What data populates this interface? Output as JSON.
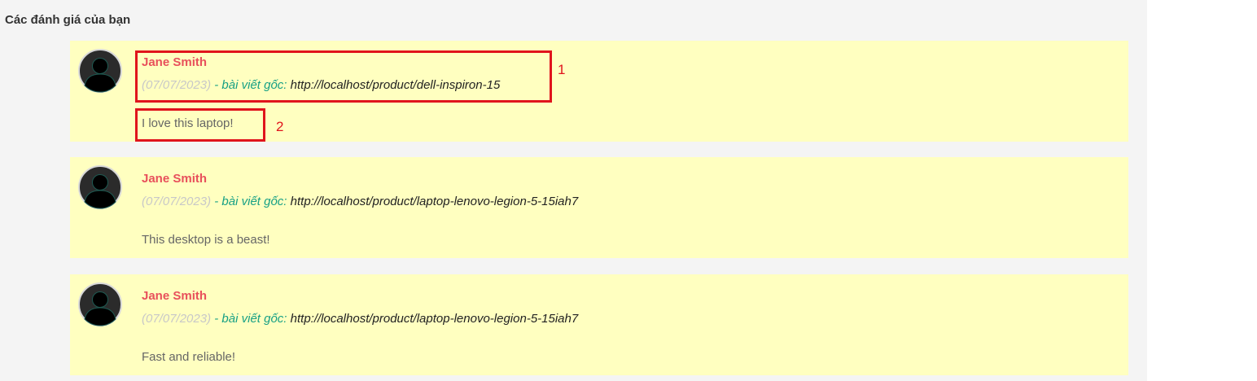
{
  "section": {
    "title": "Các đánh giá của bạn"
  },
  "reviews": [
    {
      "author": "Jane Smith",
      "date": "(07/07/2023)",
      "separator": " - ",
      "source_label": "bài viết gốc:",
      "url": " http://localhost/product/dell-inspiron-15",
      "comment": "I love this laptop!"
    },
    {
      "author": "Jane Smith",
      "date": "(07/07/2023)",
      "separator": " - ",
      "source_label": "bài viết gốc:",
      "url": " http://localhost/product/laptop-lenovo-legion-5-15iah7",
      "comment": "This desktop is a beast!"
    },
    {
      "author": "Jane Smith",
      "date": "(07/07/2023)",
      "separator": " - ",
      "source_label": "bài viết gốc:",
      "url": " http://localhost/product/laptop-lenovo-legion-5-15iah7",
      "comment": "Fast and reliable!"
    }
  ],
  "annotations": [
    {
      "label": "1"
    },
    {
      "label": "2"
    }
  ],
  "colors": {
    "panel_background": "#f4f4f4",
    "review_background": "#ffffc0",
    "author": "#e8505b",
    "date": "#c8c8c8",
    "source_label": "#17a085",
    "annotation": "#e0141c"
  },
  "icons": {
    "avatar": "user-avatar-icon"
  }
}
